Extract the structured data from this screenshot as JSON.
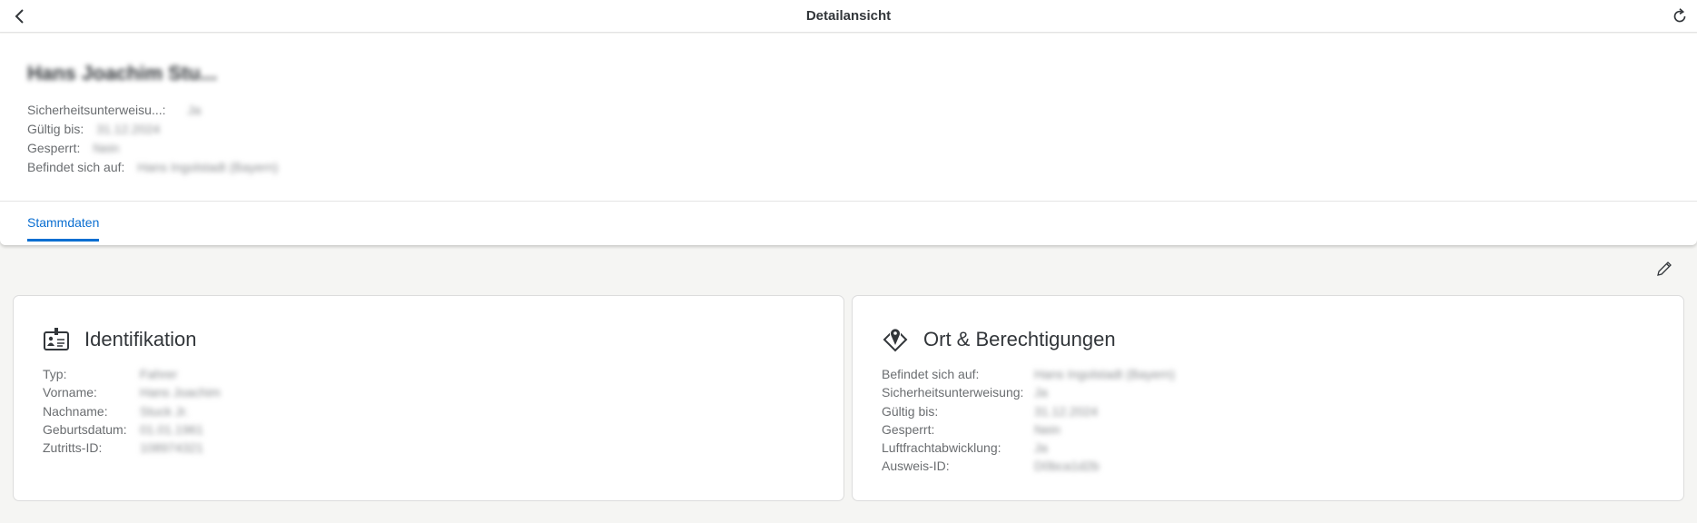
{
  "topbar": {
    "title": "Detailansicht",
    "back_icon": "chevron-left-icon",
    "refresh_icon": "refresh-icon"
  },
  "header": {
    "name": "Hans Joachim Stu...",
    "attributes": [
      {
        "label": "Sicherheitsunterweisu...:",
        "value": "Ja"
      },
      {
        "label": "Gültig bis:",
        "value": "31.12.2024"
      },
      {
        "label": "Gesperrt:",
        "value": "Nein"
      },
      {
        "label": "Befindet sich auf:",
        "value": "Hans Ingolstadt (Bayern)"
      }
    ]
  },
  "tabs": [
    {
      "label": "Stammdaten",
      "selected": true
    }
  ],
  "cards": [
    {
      "title": "Identifikation",
      "icon": "id-card-icon",
      "rows": [
        {
          "label": "Typ:",
          "value": "Fahrer"
        },
        {
          "label": "Vorname:",
          "value": "Hans Joachim"
        },
        {
          "label": "Nachname:",
          "value": "Stuck Jr."
        },
        {
          "label": "Geburtsdatum:",
          "value": "01.01.1961"
        },
        {
          "label": "Zutritts-ID:",
          "value": "108974321"
        }
      ]
    },
    {
      "title": "Ort & Berechtigungen",
      "icon": "location-icon",
      "rows": [
        {
          "label": "Befindet sich auf:",
          "value": "Hans Ingolstadt (Bayern)"
        },
        {
          "label": "Sicherheitsunterweisung:",
          "value": "Ja"
        },
        {
          "label": "Gültig bis:",
          "value": "31.12.2024"
        },
        {
          "label": "Gesperrt:",
          "value": "Nein"
        },
        {
          "label": "Luftfrachtabwicklung:",
          "value": "Ja"
        },
        {
          "label": "Ausweis-ID:",
          "value": "D0bca1d2b"
        }
      ]
    }
  ],
  "colors": {
    "accent": "#0a6ed1",
    "background": "#f5f5f3"
  }
}
